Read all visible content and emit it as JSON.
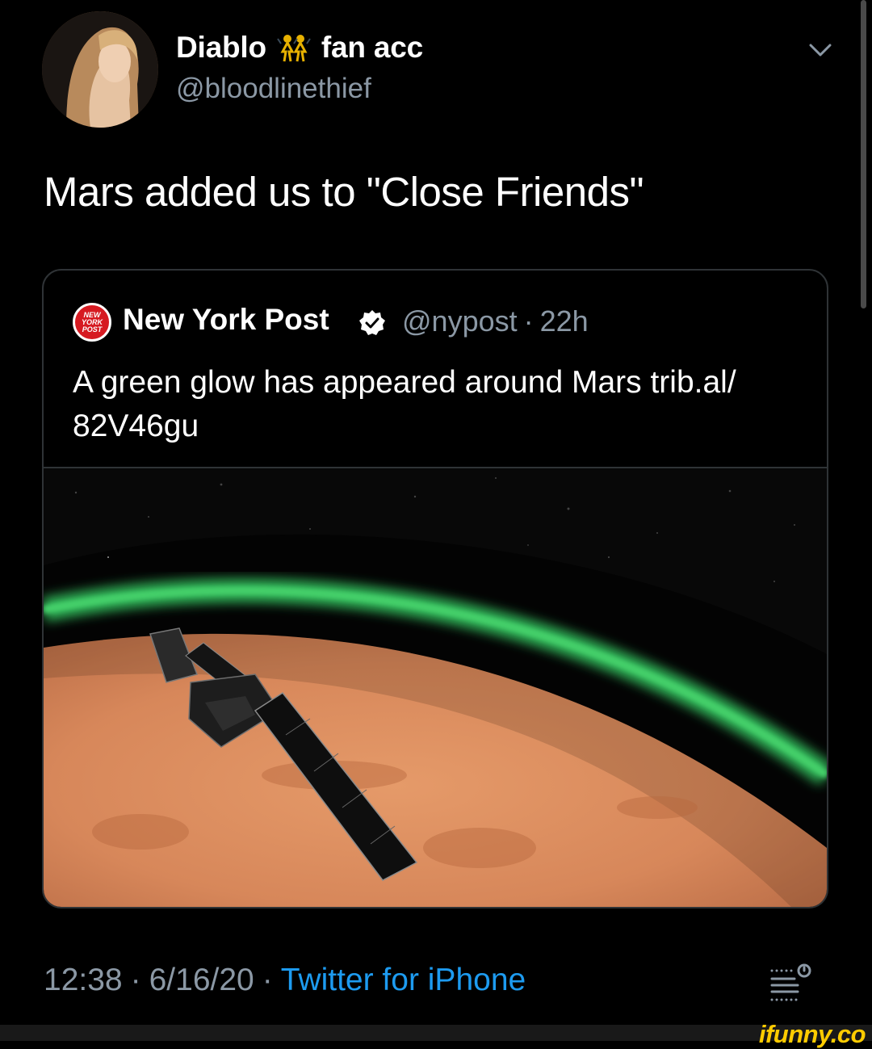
{
  "tweet": {
    "author": {
      "display_name_part1": "Diablo",
      "display_name_part2": "fan acc",
      "name_emoji": "dancers-emoji",
      "handle": "@bloodlinethief"
    },
    "text": "Mars added us to \"Close Friends\"",
    "quoted": {
      "name": "New York Post",
      "verified": true,
      "handle": "@nypost",
      "separator": "·",
      "age": "22h",
      "text": "A green glow has appeared around Mars trib.al/\n82V46gu",
      "image_alt": "satellite orbiting Mars with green glow"
    },
    "footer": {
      "time": "12:38",
      "separator": "·",
      "date": "6/16/20",
      "source": "Twitter for iPhone"
    }
  },
  "watermark": "ifunny.co",
  "colors": {
    "background": "#000000",
    "secondary_text": "#8b98a5",
    "link": "#1d9bf0",
    "border": "#2f3336",
    "glow": "#35c05a",
    "mars": "#d7875a",
    "nypost_red": "#d61a21",
    "ifunny_yellow": "#ffcc00"
  },
  "icons": [
    "chevron-down-icon",
    "verified-badge-icon",
    "analytics-icon",
    "nypost-logo"
  ]
}
